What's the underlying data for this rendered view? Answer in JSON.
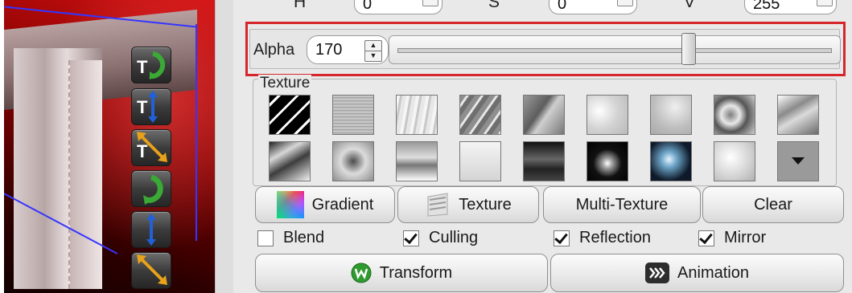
{
  "colors": {
    "highlight_frame": "#d6262b",
    "viewport_red": "#c01010",
    "panel_bg": "#e9e9e9",
    "gizmo_green": "#3aa935",
    "gizmo_blue": "#2160d8",
    "gizmo_orange": "#e8a11a"
  },
  "hsv": {
    "h_label": "H",
    "h_value": "0",
    "s_label": "S",
    "s_value": "0",
    "v_label": "V",
    "v_value": "255"
  },
  "alpha": {
    "label": "Alpha",
    "value": "170",
    "slider_fraction": 0.667
  },
  "viewport_tools": [
    {
      "name": "rotate-texture-icon",
      "letter": "T"
    },
    {
      "name": "move-texture-icon",
      "letter": "T"
    },
    {
      "name": "scale-texture-icon",
      "letter": "T"
    },
    {
      "name": "rotate-icon",
      "letter": ""
    },
    {
      "name": "move-icon",
      "letter": ""
    },
    {
      "name": "scale-icon",
      "letter": ""
    }
  ],
  "texture": {
    "title": "Texture",
    "swatches": [
      "diagonal-stripes-black",
      "noise-gray",
      "vertical-streaks",
      "diagonal-streaks",
      "scratched-gray",
      "soft-clouds",
      "light-marble",
      "marble-veins",
      "chrome-swirl",
      "dark-chrome-swirl",
      "gray-plasma",
      "sky-horizon",
      "white-haze",
      "dark-horizontal",
      "radial-light",
      "blue-radial-glow",
      "white-fade",
      "more-dropdown"
    ]
  },
  "buttons": {
    "gradient": "Gradient",
    "texture": "Texture",
    "multi_texture": "Multi-Texture",
    "clear": "Clear",
    "transform": "Transform",
    "animation": "Animation"
  },
  "options": [
    {
      "label": "Blend",
      "checked": false
    },
    {
      "label": "Culling",
      "checked": true
    },
    {
      "label": "Reflection",
      "checked": true
    },
    {
      "label": "Mirror",
      "checked": true
    }
  ]
}
